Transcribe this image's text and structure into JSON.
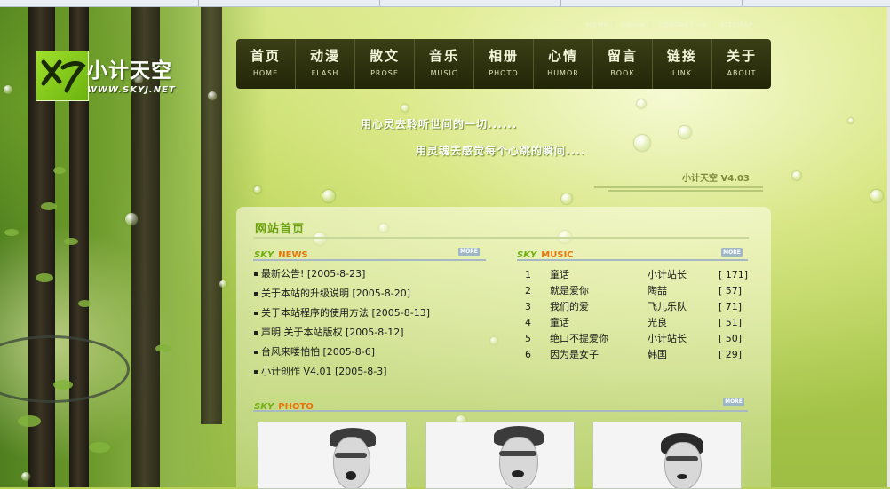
{
  "site": {
    "name": "小计天空",
    "url": "WWW.SKYJ.NET",
    "slogan1": "用心灵去聆听世间的一切......",
    "slogan2": "用灵魂去感觉每个心跳的瞬间....",
    "version": "小计天空 V4.03"
  },
  "top_links": [
    "HOME",
    "LOGIN",
    "CONTACT US",
    "SITEMAP"
  ],
  "nav": [
    {
      "cn": "首页",
      "en": "HOME"
    },
    {
      "cn": "动漫",
      "en": "FLASH"
    },
    {
      "cn": "散文",
      "en": "PROSE"
    },
    {
      "cn": "音乐",
      "en": "MUSIC"
    },
    {
      "cn": "相册",
      "en": "PHOTO"
    },
    {
      "cn": "心情",
      "en": "HUMOR"
    },
    {
      "cn": "留言",
      "en": "BOOK"
    },
    {
      "cn": "链接",
      "en": "LINK"
    },
    {
      "cn": "关于",
      "en": "ABOUT"
    }
  ],
  "panel": {
    "title": "网站首页",
    "news_sky": "SKY",
    "news_label": "NEWS",
    "music_sky": "SKY",
    "music_label": "MUSIC",
    "photo_sky": "SKY",
    "photo_label": "PHOTO",
    "more": "MORE"
  },
  "news": [
    "最新公告! [2005-8-23]",
    "关于本站的升级说明 [2005-8-20]",
    "关于本站程序的使用方法 [2005-8-13]",
    "声明 关于本站版权 [2005-8-12]",
    "台风来喽怕怕 [2005-8-6]",
    "小计创作 V4.01 [2005-8-3]"
  ],
  "music": [
    {
      "no": "1",
      "song": "童话",
      "artist": "小计站长",
      "count": "[ 171]"
    },
    {
      "no": "2",
      "song": "就是爱你",
      "artist": "陶喆",
      "count": "[ 57]"
    },
    {
      "no": "3",
      "song": "我们的爱",
      "artist": "飞儿乐队",
      "count": "[ 71]"
    },
    {
      "no": "4",
      "song": "童话",
      "artist": "光良",
      "count": "[ 51]"
    },
    {
      "no": "5",
      "song": "绝口不提爱你",
      "artist": "小计站长",
      "count": "[ 50]"
    },
    {
      "no": "6",
      "song": "因为是女子",
      "artist": "韩国",
      "count": "[ 29]"
    }
  ],
  "colors": {
    "news_label": "#e8740c",
    "music_label": "#e8740c",
    "photo_label": "#e8740c",
    "accent_green": "#6ba10e"
  }
}
